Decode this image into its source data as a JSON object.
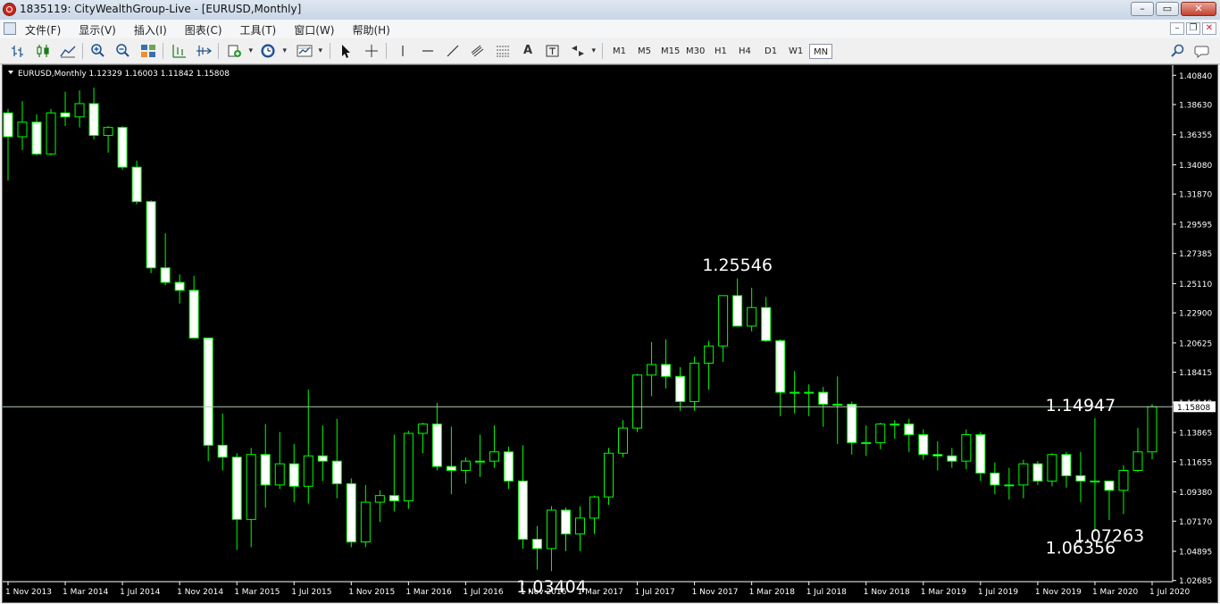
{
  "window": {
    "title": "1835119: CityWealthGroup-Live - [EURUSD,Monthly]",
    "controls": {
      "minimize": "–",
      "maximize": "▭",
      "close": "✕"
    }
  },
  "menu": {
    "items": [
      "文件(F)",
      "显示(V)",
      "插入(I)",
      "图表(C)",
      "工具(T)",
      "窗口(W)",
      "帮助(H)"
    ],
    "mdi_controls": {
      "minimize": "–",
      "restore": "❐",
      "close": "✕"
    }
  },
  "toolbar": {
    "text_tool": "A",
    "timeframes": [
      "M1",
      "M5",
      "M15",
      "M30",
      "H1",
      "H4",
      "D1",
      "W1",
      "MN"
    ],
    "active_timeframe": "MN"
  },
  "chart_data": {
    "type": "candlestick",
    "symbol_info": "EURUSD,Monthly  1.12329 1.16003 1.11842 1.15808",
    "colors": {
      "background": "#000000",
      "bull_body": "#000000",
      "bear_body": "#ffffff",
      "wick": "#00ff00",
      "price_line": "#b4c8b4",
      "axis_text": "#ffffff"
    },
    "grid": false,
    "ylim": [
      1.026,
      1.416
    ],
    "yticks": [
      "1.40840",
      "1.38630",
      "1.36355",
      "1.34080",
      "1.31870",
      "1.29595",
      "1.27385",
      "1.25110",
      "1.22900",
      "1.20625",
      "1.18415",
      "1.16140",
      "1.13865",
      "1.11655",
      "1.09380",
      "1.07170",
      "1.04895",
      "1.02685"
    ],
    "xlabels": [
      "1 Nov 2013",
      "1 Mar 2014",
      "1 Jul 2014",
      "1 Nov 2014",
      "1 Mar 2015",
      "1 Jul 2015",
      "1 Nov 2015",
      "1 Mar 2016",
      "1 Jul 2016",
      "1 Nov 2016",
      "1 Mar 2017",
      "1 Jul 2017",
      "1 Nov 2017",
      "1 Mar 2018",
      "1 Jul 2018",
      "1 Nov 2018",
      "1 Mar 2019",
      "1 Jul 2019",
      "1 Nov 2019",
      "1 Mar 2020",
      "1 Jul 2020"
    ],
    "current_price": "1.15808",
    "annotations": [
      {
        "text": "1.25546",
        "candle": 51
      },
      {
        "text": "1.03404",
        "candle": 38
      },
      {
        "text": "1.14947",
        "candle": 75
      },
      {
        "text": "1.07263",
        "candle": 77
      },
      {
        "text": "1.06356",
        "candle": 75
      }
    ],
    "candles": [
      [
        1.38,
        1.362,
        1.383,
        1.329
      ],
      [
        1.362,
        1.373,
        1.389,
        1.352
      ],
      [
        1.373,
        1.349,
        1.379,
        1.348
      ],
      [
        1.349,
        1.38,
        1.383,
        1.348
      ],
      [
        1.38,
        1.377,
        1.396,
        1.37
      ],
      [
        1.377,
        1.387,
        1.397,
        1.369
      ],
      [
        1.387,
        1.363,
        1.399,
        1.36
      ],
      [
        1.363,
        1.369,
        1.37,
        1.35
      ],
      [
        1.369,
        1.339,
        1.37,
        1.337
      ],
      [
        1.339,
        1.313,
        1.344,
        1.311
      ],
      [
        1.313,
        1.263,
        1.314,
        1.259
      ],
      [
        1.263,
        1.252,
        1.289,
        1.25
      ],
      [
        1.252,
        1.246,
        1.258,
        1.236
      ],
      [
        1.246,
        1.21,
        1.257,
        1.21
      ],
      [
        1.21,
        1.129,
        1.21,
        1.117
      ],
      [
        1.129,
        1.12,
        1.153,
        1.11
      ],
      [
        1.12,
        1.073,
        1.123,
        1.05
      ],
      [
        1.073,
        1.122,
        1.127,
        1.052
      ],
      [
        1.122,
        1.099,
        1.145,
        1.082
      ],
      [
        1.099,
        1.115,
        1.139,
        1.096
      ],
      [
        1.115,
        1.098,
        1.13,
        1.086
      ],
      [
        1.098,
        1.121,
        1.171,
        1.085
      ],
      [
        1.121,
        1.117,
        1.144,
        1.102
      ],
      [
        1.117,
        1.1,
        1.149,
        1.089
      ],
      [
        1.1,
        1.056,
        1.104,
        1.052
      ],
      [
        1.056,
        1.086,
        1.099,
        1.052
      ],
      [
        1.086,
        1.091,
        1.095,
        1.071
      ],
      [
        1.091,
        1.087,
        1.137,
        1.079
      ],
      [
        1.087,
        1.138,
        1.14,
        1.081
      ],
      [
        1.138,
        1.145,
        1.146,
        1.123
      ],
      [
        1.145,
        1.113,
        1.161,
        1.11
      ],
      [
        1.113,
        1.11,
        1.143,
        1.092
      ],
      [
        1.11,
        1.117,
        1.12,
        1.1
      ],
      [
        1.117,
        1.117,
        1.137,
        1.105
      ],
      [
        1.117,
        1.124,
        1.144,
        1.112
      ],
      [
        1.124,
        1.102,
        1.128,
        1.096
      ],
      [
        1.102,
        1.058,
        1.129,
        1.051
      ],
      [
        1.058,
        1.051,
        1.068,
        1.035
      ],
      [
        1.051,
        1.08,
        1.083,
        1.034
      ],
      [
        1.08,
        1.062,
        1.082,
        1.049
      ],
      [
        1.062,
        1.074,
        1.083,
        1.049
      ],
      [
        1.074,
        1.09,
        1.091,
        1.062
      ],
      [
        1.09,
        1.123,
        1.127,
        1.084
      ],
      [
        1.123,
        1.142,
        1.148,
        1.12
      ],
      [
        1.142,
        1.182,
        1.183,
        1.139
      ],
      [
        1.182,
        1.19,
        1.207,
        1.166
      ],
      [
        1.19,
        1.181,
        1.209,
        1.172
      ],
      [
        1.181,
        1.162,
        1.188,
        1.155
      ],
      [
        1.162,
        1.191,
        1.196,
        1.155
      ],
      [
        1.191,
        1.204,
        1.208,
        1.171
      ],
      [
        1.204,
        1.242,
        1.242,
        1.192
      ],
      [
        1.242,
        1.219,
        1.255,
        1.219
      ],
      [
        1.219,
        1.233,
        1.248,
        1.215
      ],
      [
        1.233,
        1.208,
        1.241,
        1.207
      ],
      [
        1.208,
        1.169,
        1.209,
        1.151
      ],
      [
        1.169,
        1.169,
        1.185,
        1.153
      ],
      [
        1.169,
        1.169,
        1.175,
        1.151
      ],
      [
        1.169,
        1.16,
        1.173,
        1.143
      ],
      [
        1.16,
        1.16,
        1.181,
        1.13
      ],
      [
        1.16,
        1.131,
        1.162,
        1.122
      ],
      [
        1.131,
        1.131,
        1.144,
        1.121
      ],
      [
        1.131,
        1.145,
        1.146,
        1.126
      ],
      [
        1.145,
        1.145,
        1.148,
        1.134
      ],
      [
        1.145,
        1.137,
        1.149,
        1.124
      ],
      [
        1.137,
        1.122,
        1.141,
        1.118
      ],
      [
        1.122,
        1.121,
        1.132,
        1.11
      ],
      [
        1.121,
        1.117,
        1.127,
        1.112
      ],
      [
        1.117,
        1.137,
        1.141,
        1.111
      ],
      [
        1.137,
        1.108,
        1.139,
        1.102
      ],
      [
        1.108,
        1.099,
        1.116,
        1.092
      ],
      [
        1.099,
        1.099,
        1.112,
        1.088
      ],
      [
        1.099,
        1.115,
        1.118,
        1.089
      ],
      [
        1.115,
        1.102,
        1.117,
        1.099
      ],
      [
        1.102,
        1.122,
        1.123,
        1.098
      ],
      [
        1.122,
        1.106,
        1.124,
        1.097
      ],
      [
        1.106,
        1.102,
        1.124,
        1.086
      ],
      [
        1.102,
        1.102,
        1.1495,
        1.0636
      ],
      [
        1.102,
        1.095,
        1.1,
        1.0726
      ],
      [
        1.095,
        1.11,
        1.114,
        1.077
      ],
      [
        1.11,
        1.124,
        1.142,
        1.109
      ],
      [
        1.124,
        1.1581,
        1.16,
        1.1184
      ]
    ]
  }
}
